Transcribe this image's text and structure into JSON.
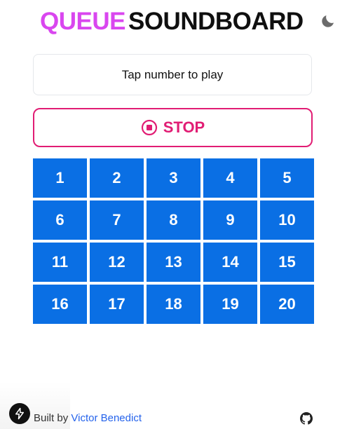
{
  "header": {
    "title_part1": "QUEUE",
    "title_part2": "SOUNDBOARD",
    "theme_icon": "moon-icon"
  },
  "instructions": {
    "text": "Tap number to play"
  },
  "stop": {
    "label": "STOP",
    "icon": "stop-circle-icon"
  },
  "numbers": [
    "1",
    "2",
    "3",
    "4",
    "5",
    "6",
    "7",
    "8",
    "9",
    "10",
    "11",
    "12",
    "13",
    "14",
    "15",
    "16",
    "17",
    "18",
    "19",
    "20"
  ],
  "footer": {
    "built_by": "Built by",
    "author": "Victor Benedict",
    "logo_icon": "lightning-logo-icon",
    "github_icon": "github-icon"
  },
  "colors": {
    "accent_pink": "#d946ef",
    "stop_red": "#e11d74",
    "button_blue": "#0a6fe4",
    "link_blue": "#2563eb"
  }
}
